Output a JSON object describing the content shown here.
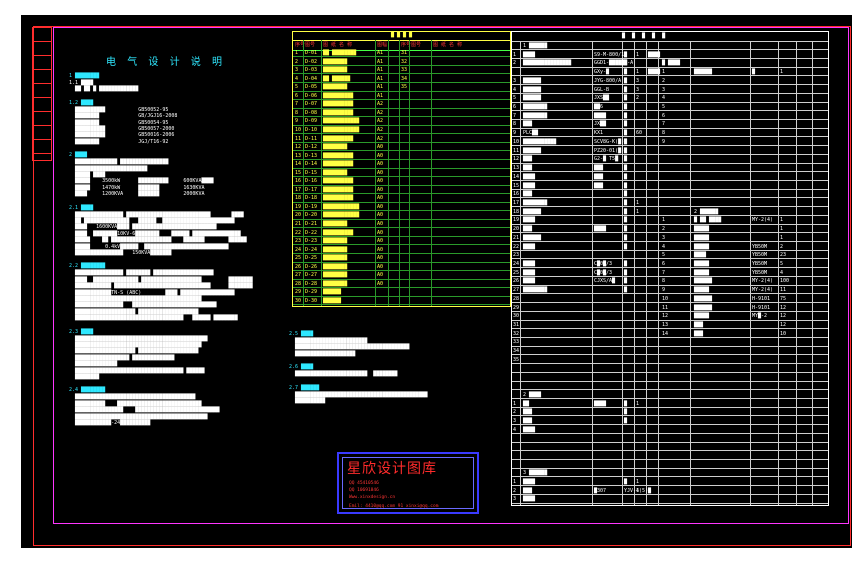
{
  "drawing": {
    "title": "电 气 设 计 说 明",
    "watermark_title": "星欣设计图库",
    "watermark_lines": [
      "QQ 45410546",
      "QQ 10691846",
      "Www.xinxdesign.cn",
      "Emil: 4410@qq.com 91 xinxi@qq.com"
    ],
    "side_cells": [
      "",
      "",
      "",
      "",
      "",
      "",
      "",
      "",
      ""
    ]
  },
  "notes": {
    "sections": [
      {
        "heading": "1 ████████",
        "lines": [
          "1.1 ████",
          "  ██ ██ █ █████████████"
        ]
      },
      {
        "heading": "1.2 ████",
        "lines": [
          "  ██████████           GB50052-95",
          "  ████████             GB/JGJ16-2008",
          "  ████████             GB50054-95",
          "  ██████████           GB50057-2000",
          "  ██████████           GB50016-2006",
          "  ████████             JGJ/T16-92"
        ]
      },
      {
        "heading": "2 ████",
        "lines": [
          "  ██████████████ ████████████████",
          "  ████████████████████████",
          "  █████ ████",
          "  █████    3500kW      ██████████     600KVA████",
          "  █████    1470kW      ███████        1630KVA",
          "  ████     1200KVA     ███████        2000KVA"
        ]
      },
      {
        "heading": "2.1 ████",
        "lines": [
          "  ████████████████ ████████████████████████████       ████",
          "  ██ ███████████████   ██████  ████████████████████████",
          "  ████   1600KVA████ ████████████████████████████",
          "  ████  ████████10KV-6████████    ██████ ████████████████",
          "  █████    ██ ████████████████████    ███████        ██████",
          "  █████     0.4kV██████  ████████████████████████████",
          "  ████████████████   150KVA███████"
        ]
      },
      {
        "heading": "2.2 ████████",
        "lines": [
          "  ████████████████ ████████ ████████████████████",
          "  ████  ███████████████ ████████████████████         ████████",
          "  ████████████ ████████████████████████████████      ████████",
          "  ████████████TN-S (ABC)        ████ ██████████████████",
          "  ██████████████████████████████████████████",
          "  ████████████████   ████████████████████████████",
          "  ████████████████████ ████████████████████",
          "  ████████████████████████████████████   ██████ ████████"
        ]
      },
      {
        "heading": "2.3 ████",
        "lines": [
          "  ████████████████████████████████████████████",
          "  ██████████████████████████████████████████",
          "  ████████████████████ ████████████████████",
          "  ██████████████████ ██████████████",
          "  ██████████████",
          "  ████████████████████████████████████ ██████",
          "  ████████"
        ]
      },
      {
        "heading": "2.4 ████████",
        "lines": [
          "  ████████████████████████████████████████",
          "  ██████████    ████████████████████████████",
          "  ████████████████    ████████████████████████████",
          "  ████████████████████████████████████████████",
          "  ████████████-24██████████"
        ]
      }
    ],
    "middle_sections": [
      {
        "heading": "2.5 ████",
        "lines": [
          "  ████████████████████████",
          "  ██████████████████████████████████████",
          "  ████████████████████"
        ]
      },
      {
        "heading": "2.6 ████",
        "lines": [
          "  ████████████████████████  ████████"
        ]
      },
      {
        "heading": "2.7 ██████",
        "lines": [
          "  ████████████████████████████████████████████",
          "  ██████████"
        ]
      }
    ]
  },
  "drawing_list": {
    "header": "█ █ █ █",
    "columns": [
      "序号",
      "图号",
      "图 纸 名 称",
      "图幅",
      "序号",
      "图号",
      "图 纸 名 称"
    ],
    "rows": [
      [
        "1",
        "D-01",
        "██ ████████",
        "A1",
        "31"
      ],
      [
        "2",
        "D-02",
        "████████",
        "A1",
        "32"
      ],
      [
        "3",
        "D-03",
        "████████",
        "A1",
        "33"
      ],
      [
        "4",
        "D-04",
        "██ ██████",
        "A1",
        "34"
      ],
      [
        "5",
        "D-05",
        "████████",
        "A1",
        "35"
      ],
      [
        "6",
        "D-06",
        "██████████",
        "A1",
        ""
      ],
      [
        "7",
        "D-07",
        "██████████",
        "A2",
        ""
      ],
      [
        "8",
        "D-08",
        "██████████",
        "A2",
        ""
      ],
      [
        "9",
        "D-09",
        "████████████",
        "A2",
        ""
      ],
      [
        "10",
        "D-10",
        "████████████",
        "A2",
        ""
      ],
      [
        "11",
        "D-11",
        "██████████",
        "A2",
        ""
      ],
      [
        "12",
        "D-12",
        "████████",
        "A0",
        ""
      ],
      [
        "13",
        "D-13",
        "██████████",
        "A0",
        ""
      ],
      [
        "14",
        "D-14",
        "██████████",
        "A0",
        ""
      ],
      [
        "15",
        "D-15",
        "████████",
        "A0",
        ""
      ],
      [
        "16",
        "D-16",
        "██████████",
        "A0",
        ""
      ],
      [
        "17",
        "D-17",
        "██████████",
        "A0",
        ""
      ],
      [
        "18",
        "D-18",
        "██████████",
        "A0",
        ""
      ],
      [
        "19",
        "D-19",
        "████████████",
        "A0",
        ""
      ],
      [
        "20",
        "D-20",
        "████████████",
        "A0",
        ""
      ],
      [
        "21",
        "D-21",
        "████████",
        "A0",
        ""
      ],
      [
        "22",
        "D-22",
        "██████████",
        "A0",
        ""
      ],
      [
        "23",
        "D-23",
        "████████",
        "A0",
        ""
      ],
      [
        "24",
        "D-24",
        "████████",
        "A0",
        ""
      ],
      [
        "25",
        "D-25",
        "████████",
        "A0",
        ""
      ],
      [
        "26",
        "D-26",
        "████████",
        "A0",
        ""
      ],
      [
        "27",
        "D-27",
        "████████",
        "A0",
        ""
      ],
      [
        "28",
        "D-28",
        "████████",
        "A0",
        ""
      ],
      [
        "29",
        "D-29",
        "██████",
        "",
        ""
      ],
      [
        "30",
        "D-30",
        "██████",
        "",
        ""
      ]
    ]
  },
  "equipment": {
    "header": "█ █ █ █ █",
    "rows": [
      [
        "",
        "1 ██████",
        "",
        "",
        "",
        "",
        "",
        "",
        "",
        ""
      ],
      [
        "1",
        "████",
        "S9-M-800/10",
        "█",
        "1",
        "████",
        "",
        "",
        "",
        ""
      ],
      [
        "2",
        "████████████████",
        "GGD1-██████-A",
        "█",
        "",
        "",
        "█ ████",
        "",
        "",
        ""
      ],
      [
        "",
        "",
        "GXy-█",
        "█",
        "1",
        "████",
        "1",
        "██████",
        "█",
        "1"
      ],
      [
        "3",
        "██████",
        "JYG-800/A",
        "█",
        "3",
        "",
        "2",
        "",
        "",
        ""
      ],
      [
        "4",
        "██████",
        "GGL-B",
        "█",
        "3",
        "",
        "3",
        "",
        "",
        ""
      ],
      [
        "5",
        "██████",
        "JXS██",
        "█",
        "2",
        "",
        "4",
        "",
        "",
        ""
      ],
      [
        "6",
        "████████",
        "██6",
        "█",
        "",
        "",
        "5",
        "",
        "",
        ""
      ],
      [
        "7",
        "████████",
        "████",
        "█",
        "",
        "",
        "6",
        "",
        "",
        ""
      ],
      [
        "8",
        "███",
        "JX██",
        "█",
        "",
        "",
        "7",
        "",
        "",
        ""
      ],
      [
        "9",
        "PLC██",
        "KX1",
        "█",
        "60",
        "",
        "8",
        "",
        "",
        ""
      ],
      [
        "10",
        "███████████",
        "SCV8G-K(█)",
        "█",
        "",
        "",
        "9",
        "",
        "",
        ""
      ],
      [
        "11",
        "██████",
        "PZ20-01(█)",
        "█",
        "",
        "",
        "",
        "",
        "",
        ""
      ],
      [
        "12",
        "███",
        "G2-█ T5█",
        "█",
        "",
        "",
        "",
        "",
        "",
        ""
      ],
      [
        "13",
        "███",
        "███",
        "█",
        "",
        "",
        "",
        "",
        "",
        ""
      ],
      [
        "14",
        "████",
        "███",
        "█",
        "",
        "",
        "",
        "",
        "",
        ""
      ],
      [
        "15",
        "████",
        "███",
        "█",
        "",
        "",
        "",
        "",
        "",
        ""
      ],
      [
        "16",
        "███",
        "",
        "█",
        "",
        "",
        "",
        "",
        "",
        ""
      ],
      [
        "17",
        "████████",
        "",
        "█",
        "1",
        "",
        "",
        "",
        "",
        ""
      ],
      [
        "18",
        "██████",
        "",
        "█",
        "1",
        "",
        "",
        "2 ██████",
        "",
        ""
      ],
      [
        "19",
        "████",
        "",
        "█",
        "",
        "",
        "1",
        "█ ██ ████",
        "MY-2(4)",
        "1"
      ],
      [
        "20",
        "███",
        "████",
        "█",
        "",
        "",
        "2",
        "█████",
        "",
        "1"
      ],
      [
        "21",
        "██████",
        "",
        "█",
        "",
        "",
        "3",
        "█████",
        "",
        "1"
      ],
      [
        "22",
        "████",
        "",
        "█",
        "",
        "",
        "4",
        "█████",
        "YB50M",
        "2"
      ],
      [
        "23",
        "",
        "",
        "",
        "",
        "",
        "5",
        "████",
        "YB50M",
        "23"
      ],
      [
        "24",
        "████",
        "C█0█/3",
        "█",
        "",
        "",
        "6",
        "█████",
        "YB50M",
        "5"
      ],
      [
        "25",
        "████",
        "C█0█/3",
        "█",
        "",
        "",
        "7",
        "█████",
        "YB50M",
        "4"
      ],
      [
        "26",
        "████",
        "CJXS/A█",
        "█",
        "",
        "",
        "8",
        "██████",
        "MY-2(4)",
        "100"
      ],
      [
        "27",
        "████████",
        "",
        "█",
        "",
        "",
        "9",
        "█████",
        "MY-2(4)",
        "11"
      ],
      [
        "28",
        "",
        "",
        "",
        "",
        "",
        "10",
        "██████",
        "H-9101",
        "75"
      ],
      [
        "29",
        "",
        "",
        "",
        "",
        "",
        "11",
        "██████",
        "H-9101",
        "12"
      ],
      [
        "30",
        "",
        "",
        "",
        "",
        "",
        "12",
        "█████",
        "MY█-2",
        "12"
      ],
      [
        "31",
        "",
        "",
        "",
        "",
        "",
        "13",
        "███",
        "",
        "12"
      ],
      [
        "32",
        "",
        "",
        "",
        "",
        "",
        "14",
        "███",
        "",
        "10"
      ],
      [
        "33",
        "",
        "",
        "",
        "",
        "",
        "",
        "",
        "",
        ""
      ],
      [
        "34",
        "",
        "",
        "",
        "",
        "",
        "",
        "",
        "",
        ""
      ],
      [
        "35",
        "",
        "",
        "",
        "",
        "",
        "",
        "",
        "",
        ""
      ],
      [
        "",
        "",
        "",
        "",
        "",
        "",
        "",
        "",
        "",
        ""
      ],
      [
        "",
        "",
        "",
        "",
        "",
        "",
        "",
        "",
        "",
        ""
      ],
      [
        "",
        "",
        "",
        "",
        "",
        "",
        "",
        "",
        "",
        ""
      ],
      [
        "",
        "2 ████",
        "",
        "",
        "",
        "",
        "",
        "",
        "",
        ""
      ],
      [
        "1",
        "██",
        "████",
        "█",
        "1",
        "",
        "",
        "",
        "",
        ""
      ],
      [
        "2",
        "███",
        "",
        "█",
        "",
        "",
        "",
        "",
        "",
        ""
      ],
      [
        "3",
        "███",
        "",
        "█",
        "",
        "",
        "",
        "",
        "",
        ""
      ],
      [
        "4",
        "████",
        "",
        "",
        "",
        "",
        "",
        "",
        "",
        ""
      ],
      [
        "",
        "",
        "",
        "",
        "",
        "",
        "",
        "",
        "",
        ""
      ],
      [
        "",
        "",
        "",
        "",
        "",
        "",
        "",
        "",
        "",
        ""
      ],
      [
        "",
        "",
        "",
        "",
        "",
        "",
        "",
        "",
        "",
        ""
      ],
      [
        "",
        "",
        "",
        "",
        "",
        "",
        "",
        "",
        "",
        ""
      ],
      [
        "",
        "3 ██████",
        "",
        "",
        "",
        "",
        "",
        "",
        "",
        ""
      ],
      [
        "1",
        "████",
        "",
        "█",
        "1",
        "",
        "",
        "",
        "",
        ""
      ],
      [
        "2",
        "███",
        "█307",
        "YJV-4(5)",
        "1",
        "█",
        "",
        "",
        "",
        ""
      ],
      [
        "3",
        "████",
        "",
        "",
        "",
        "",
        "",
        "",
        "",
        ""
      ]
    ]
  }
}
